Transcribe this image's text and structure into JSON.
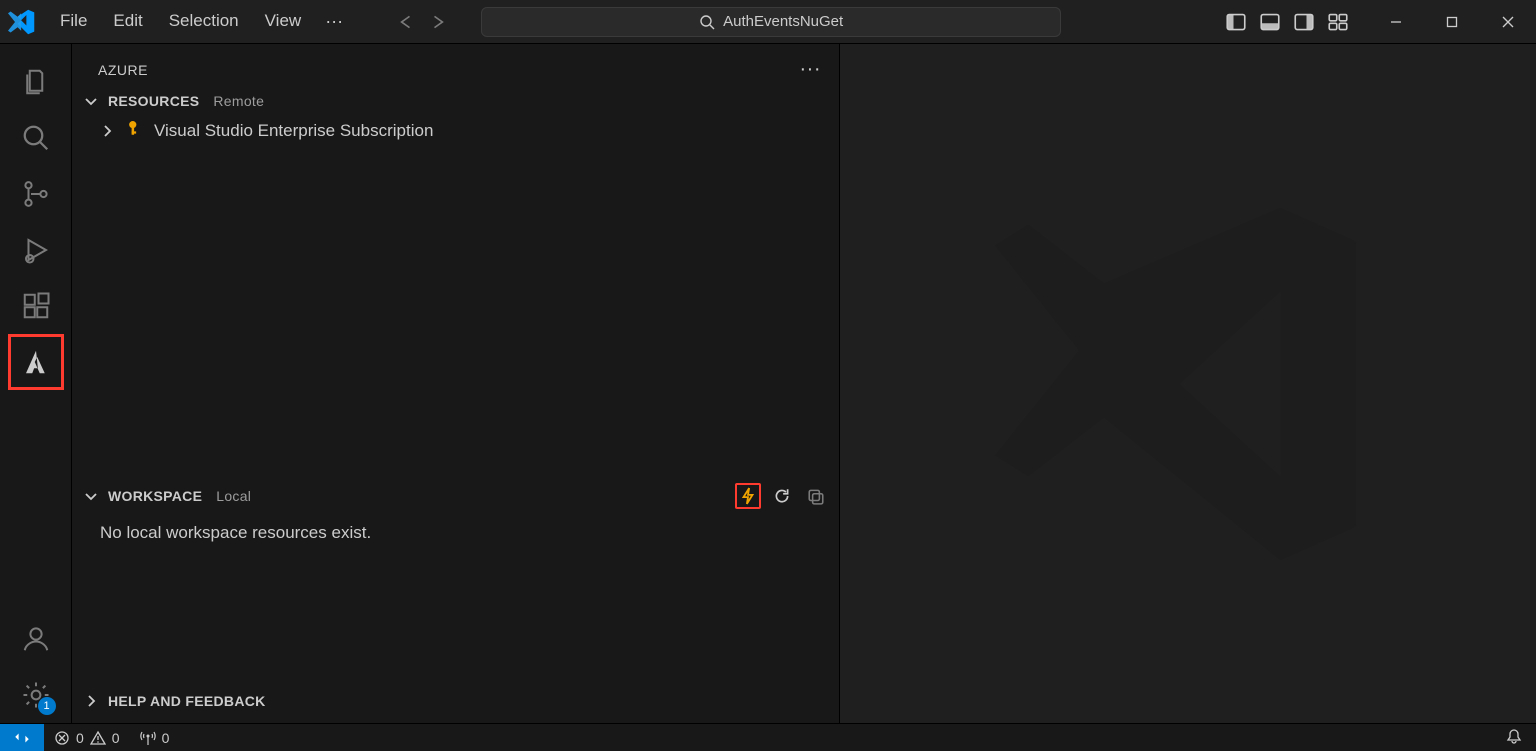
{
  "menu": {
    "file": "File",
    "edit": "Edit",
    "selection": "Selection",
    "view": "View",
    "more": "···"
  },
  "search": {
    "text": "AuthEventsNuGet"
  },
  "activitybar": {
    "settings_badge": "1"
  },
  "sidebar": {
    "title": "AZURE",
    "resources": {
      "header": "RESOURCES",
      "sub": "Remote",
      "subscription": "Visual Studio Enterprise Subscription"
    },
    "workspace": {
      "header": "WORKSPACE",
      "sub": "Local",
      "empty_msg": "No local workspace resources exist."
    },
    "help": {
      "header": "HELP AND FEEDBACK"
    }
  },
  "statusbar": {
    "errors": "0",
    "warnings": "0",
    "ports": "0"
  }
}
